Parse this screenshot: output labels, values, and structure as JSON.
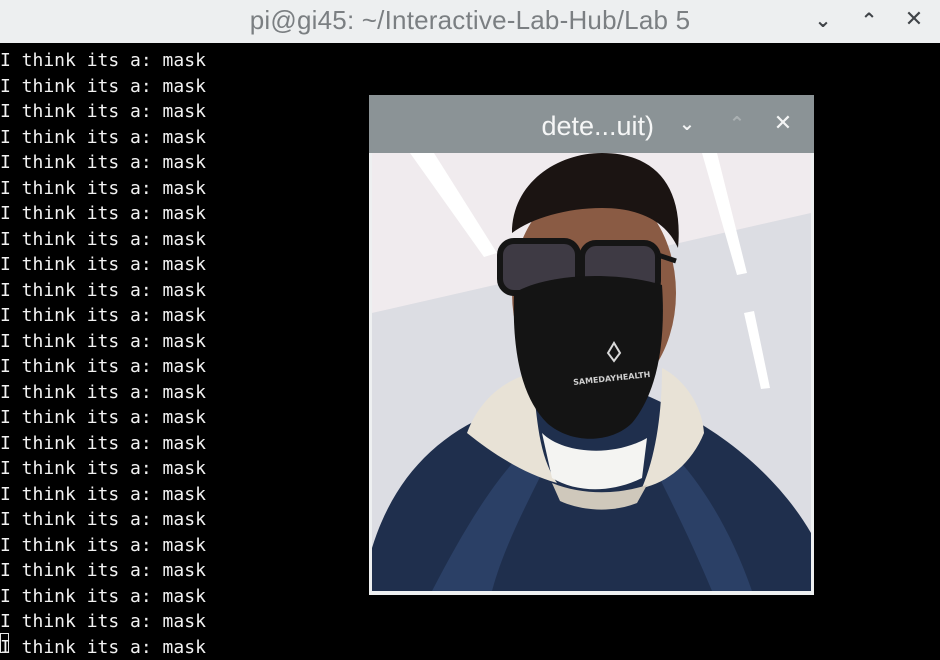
{
  "window": {
    "title": "pi@gi45: ~/Interactive-Lab-Hub/Lab 5",
    "controls": {
      "minimize": "⌄",
      "maximize": "⌃",
      "close": "✕"
    }
  },
  "terminal": {
    "lines": [
      "I think its a: mask",
      "I think its a: mask",
      "I think its a: mask",
      "I think its a: mask",
      "I think its a: mask",
      "I think its a: mask",
      "I think its a: mask",
      "I think its a: mask",
      "I think its a: mask",
      "I think its a: mask",
      "I think its a: mask",
      "I think its a: mask",
      "I think its a: mask",
      "I think its a: mask",
      "I think its a: mask",
      "I think its a: mask",
      "I think its a: mask",
      "I think its a: mask",
      "I think its a: mask",
      "I think its a: mask",
      "I think its a: mask",
      "I think its a: mask",
      "I think its a: mask",
      "I think its a: mask"
    ]
  },
  "popup": {
    "title": "dete...uit)",
    "controls": {
      "minimize": "⌄",
      "maximize": "⌃",
      "close": "✕"
    },
    "camera": {
      "description_icon": "webcam-feed-person-with-mask",
      "mask_brand": "SAMEDAYHEALTH"
    }
  }
}
